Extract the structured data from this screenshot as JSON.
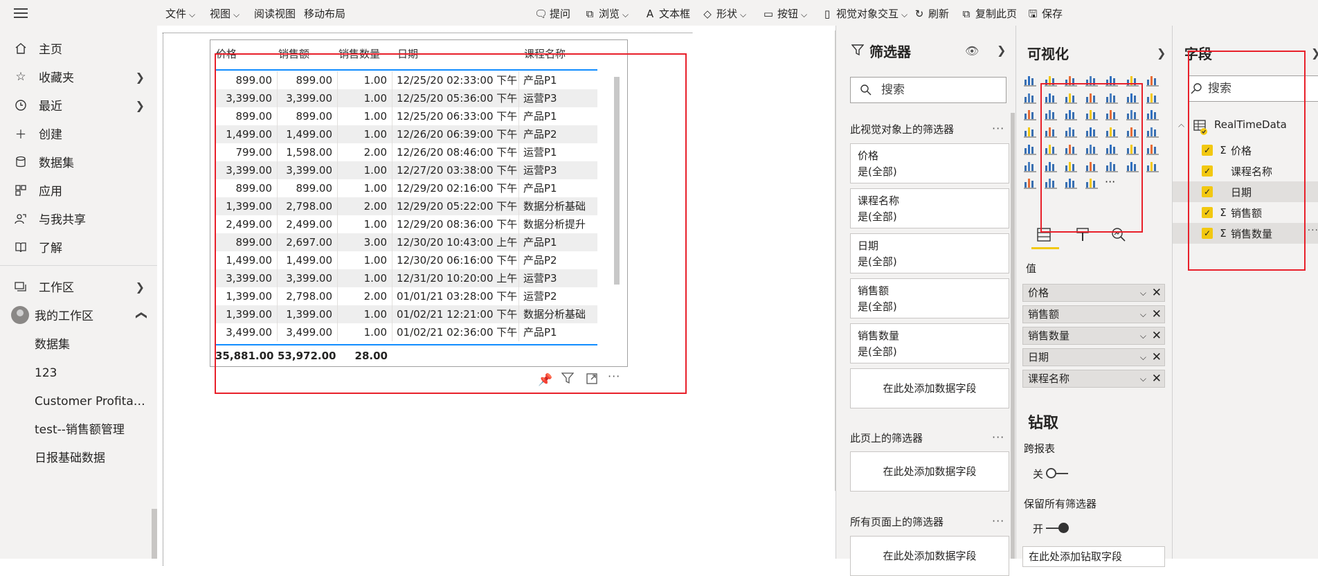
{
  "nav": {
    "items": [
      {
        "icon": "home-icon",
        "label": "主页",
        "chevron": false
      },
      {
        "icon": "star-icon",
        "label": "收藏夹",
        "chevron": true
      },
      {
        "icon": "clock-icon",
        "label": "最近",
        "chevron": true
      },
      {
        "icon": "plus-icon",
        "label": "创建",
        "chevron": false
      },
      {
        "icon": "database-icon",
        "label": "数据集",
        "chevron": false
      },
      {
        "icon": "apps-icon",
        "label": "应用",
        "chevron": false
      },
      {
        "icon": "shared-icon",
        "label": "与我共享",
        "chevron": false
      },
      {
        "icon": "book-icon",
        "label": "了解",
        "chevron": false
      }
    ],
    "workspaces_label": "工作区",
    "my_workspace_label": "我的工作区",
    "sub_items": [
      "数据集",
      "123",
      "Customer Profitabi...",
      "test--销售额管理",
      "日报基础数据"
    ]
  },
  "ribbon": {
    "file": "文件",
    "view": "视图",
    "reading_view": "阅读视图",
    "mobile_layout": "移动布局",
    "ask_question": "提问",
    "browse": "浏览",
    "textbox": "文本框",
    "shapes": "形状",
    "buttons": "按钮",
    "visual_interaction": "视觉对象交互",
    "refresh": "刷新",
    "duplicate_page": "复制此页",
    "save": "保存"
  },
  "table": {
    "headers": [
      "价格",
      "销售额",
      "销售数量",
      "日期",
      "课程名称"
    ],
    "rows": [
      [
        "899.00",
        "899.00",
        "1.00",
        "12/25/20 02:33:00 下午",
        "产品P1"
      ],
      [
        "3,399.00",
        "3,399.00",
        "1.00",
        "12/25/20 05:36:00 下午",
        "运营P3"
      ],
      [
        "899.00",
        "899.00",
        "1.00",
        "12/25/20 06:33:00 下午",
        "产品P1"
      ],
      [
        "1,499.00",
        "1,499.00",
        "1.00",
        "12/26/20 06:39:00 下午",
        "产品P2"
      ],
      [
        "799.00",
        "1,598.00",
        "2.00",
        "12/26/20 08:46:00 下午",
        "运营P1"
      ],
      [
        "3,399.00",
        "3,399.00",
        "1.00",
        "12/27/20 03:38:00 下午",
        "运营P3"
      ],
      [
        "899.00",
        "899.00",
        "1.00",
        "12/29/20 02:16:00 下午",
        "产品P1"
      ],
      [
        "1,399.00",
        "2,798.00",
        "2.00",
        "12/29/20 05:22:00 下午",
        "数据分析基础"
      ],
      [
        "2,499.00",
        "2,499.00",
        "1.00",
        "12/29/20 08:36:00 下午",
        "数据分析提升"
      ],
      [
        "899.00",
        "2,697.00",
        "3.00",
        "12/30/20 10:43:00 上午",
        "产品P1"
      ],
      [
        "1,499.00",
        "1,499.00",
        "1.00",
        "12/30/20 06:16:00 下午",
        "产品P2"
      ],
      [
        "3,399.00",
        "3,399.00",
        "1.00",
        "12/31/20 10:20:00 上午",
        "运营P3"
      ],
      [
        "1,399.00",
        "2,798.00",
        "2.00",
        "01/01/21 03:28:00 下午",
        "运营P2"
      ],
      [
        "1,399.00",
        "1,399.00",
        "1.00",
        "01/02/21 12:21:00 下午",
        "数据分析基础"
      ],
      [
        "3,499.00",
        "3,499.00",
        "1.00",
        "01/02/21 02:36:00 下午",
        "产品P1"
      ]
    ],
    "totals": [
      "35,881.00",
      "53,972.00",
      "28.00"
    ]
  },
  "filters": {
    "title": "筛选器",
    "search_placeholder": "搜索",
    "visual_section": "此视觉对象上的筛选器",
    "cards": [
      {
        "name": "价格",
        "value": "是(全部)"
      },
      {
        "name": "课程名称",
        "value": "是(全部)"
      },
      {
        "name": "日期",
        "value": "是(全部)"
      },
      {
        "name": "销售额",
        "value": "是(全部)"
      },
      {
        "name": "销售数量",
        "value": "是(全部)"
      }
    ],
    "add_field": "在此处添加数据字段",
    "page_section": "此页上的筛选器",
    "all_pages_section": "所有页面上的筛选器"
  },
  "viz": {
    "title": "可视化",
    "values_label": "值",
    "wells": [
      "价格",
      "销售额",
      "销售数量",
      "日期",
      "课程名称"
    ],
    "drill_title": "钻取",
    "cross_report": "跨报表",
    "off": "关",
    "keep_filters": "保留所有筛选器",
    "on": "开",
    "drill_field": "在此处添加钻取字段",
    "more": "···"
  },
  "fields": {
    "title": "字段",
    "search_placeholder": "搜索",
    "table_name": "RealTimeData",
    "items": [
      {
        "label": "价格",
        "sigma": true
      },
      {
        "label": "课程名称",
        "sigma": false
      },
      {
        "label": "日期",
        "sigma": false
      },
      {
        "label": "销售额",
        "sigma": true
      },
      {
        "label": "销售数量",
        "sigma": true
      }
    ]
  },
  "colors": {
    "accent": "#118dff",
    "checkbox": "#f2c811",
    "annotation": "#e8202a",
    "pane_bg": "#f3f2f1"
  }
}
